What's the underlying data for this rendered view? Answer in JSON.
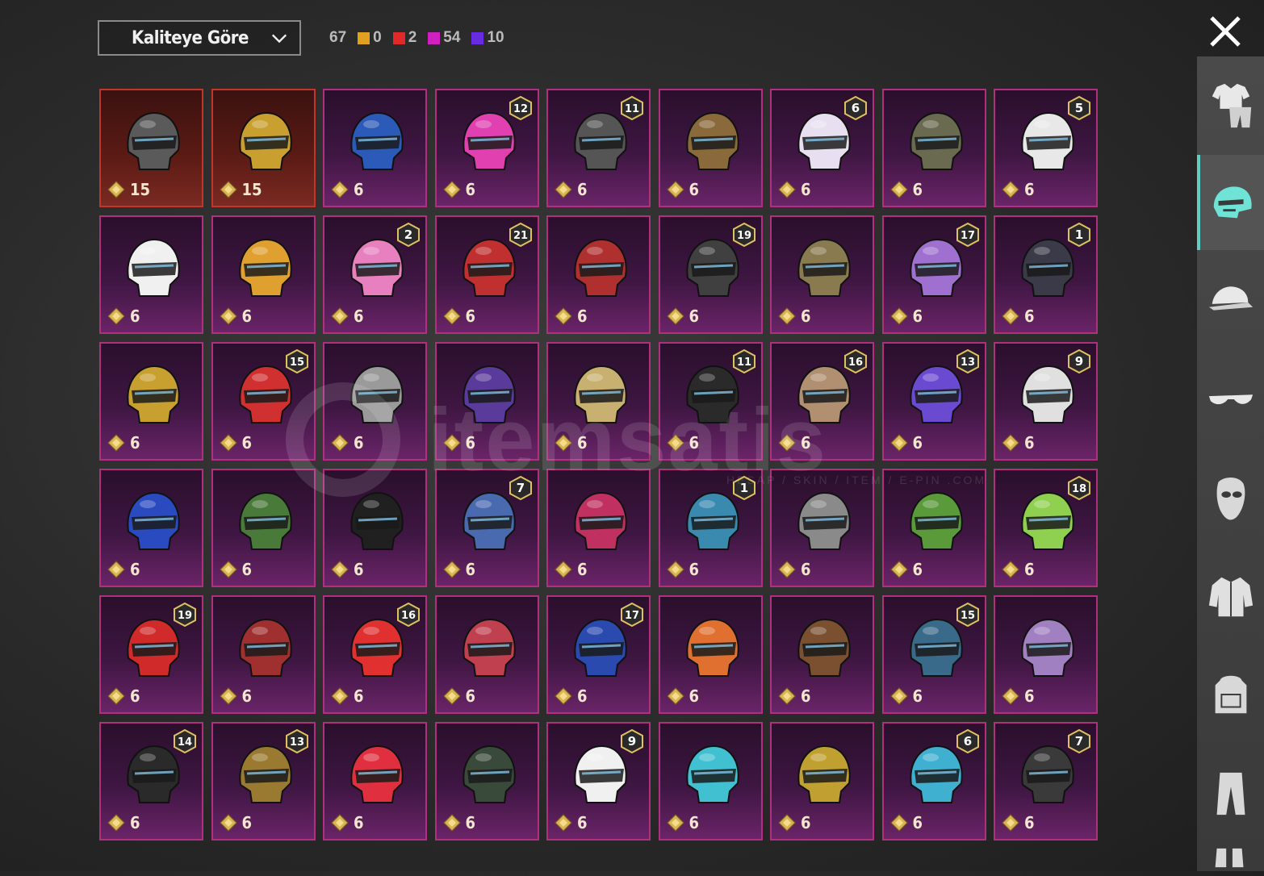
{
  "sort": {
    "label": "Kaliteye Göre"
  },
  "counts": {
    "total": "67",
    "legendary": {
      "value": "0",
      "color": "#e0a020"
    },
    "epic_red": {
      "value": "2",
      "color": "#e02a2a"
    },
    "pink": {
      "value": "54",
      "color": "#d020c0"
    },
    "purple": {
      "value": "10",
      "color": "#6a2ae0"
    }
  },
  "watermark": {
    "text": "itemsatis",
    "sub": "HESAP / SKIN / ITEM / E-PIN .COM"
  },
  "items": [
    {
      "cost": "15",
      "level": "",
      "tier": "legend",
      "color": "#5a5a5a"
    },
    {
      "cost": "15",
      "level": "",
      "tier": "legend",
      "color": "#c9a030"
    },
    {
      "cost": "6",
      "level": "",
      "tier": "epic",
      "color": "#2c5ab8"
    },
    {
      "cost": "6",
      "level": "12",
      "tier": "epic",
      "color": "#e040b0"
    },
    {
      "cost": "6",
      "level": "11",
      "tier": "epic",
      "color": "#555555"
    },
    {
      "cost": "6",
      "level": "",
      "tier": "epic",
      "color": "#8a6a3a"
    },
    {
      "cost": "6",
      "level": "6",
      "tier": "epic",
      "color": "#e8e0f0"
    },
    {
      "cost": "6",
      "level": "",
      "tier": "epic",
      "color": "#6a6a50"
    },
    {
      "cost": "6",
      "level": "5",
      "tier": "epic",
      "color": "#e8e8e8"
    },
    {
      "cost": "6",
      "level": "",
      "tier": "epic",
      "color": "#f0f0f0"
    },
    {
      "cost": "6",
      "level": "",
      "tier": "epic",
      "color": "#e0a030"
    },
    {
      "cost": "6",
      "level": "2",
      "tier": "epic",
      "color": "#e880c0"
    },
    {
      "cost": "6",
      "level": "21",
      "tier": "epic",
      "color": "#c03030"
    },
    {
      "cost": "6",
      "level": "",
      "tier": "epic",
      "color": "#b03030"
    },
    {
      "cost": "6",
      "level": "19",
      "tier": "epic",
      "color": "#404040"
    },
    {
      "cost": "6",
      "level": "",
      "tier": "epic",
      "color": "#8a7a50"
    },
    {
      "cost": "6",
      "level": "17",
      "tier": "epic",
      "color": "#a070d0"
    },
    {
      "cost": "6",
      "level": "1",
      "tier": "epic",
      "color": "#3a3a48"
    },
    {
      "cost": "6",
      "level": "",
      "tier": "epic",
      "color": "#c8a030"
    },
    {
      "cost": "6",
      "level": "15",
      "tier": "epic",
      "color": "#d03030"
    },
    {
      "cost": "6",
      "level": "",
      "tier": "epic",
      "color": "#9a9a9a"
    },
    {
      "cost": "6",
      "level": "",
      "tier": "epic",
      "color": "#5a3a9a"
    },
    {
      "cost": "6",
      "level": "",
      "tier": "epic",
      "color": "#c8b070"
    },
    {
      "cost": "6",
      "level": "11",
      "tier": "epic",
      "color": "#2a2a2a"
    },
    {
      "cost": "6",
      "level": "16",
      "tier": "epic",
      "color": "#b09070"
    },
    {
      "cost": "6",
      "level": "13",
      "tier": "epic",
      "color": "#6a4ad0"
    },
    {
      "cost": "6",
      "level": "9",
      "tier": "epic",
      "color": "#e0e0e0"
    },
    {
      "cost": "6",
      "level": "",
      "tier": "epic",
      "color": "#2a4ac0"
    },
    {
      "cost": "6",
      "level": "",
      "tier": "epic",
      "color": "#4a7a3a"
    },
    {
      "cost": "6",
      "level": "",
      "tier": "epic",
      "color": "#202020"
    },
    {
      "cost": "6",
      "level": "7",
      "tier": "epic",
      "color": "#4a6ab0"
    },
    {
      "cost": "6",
      "level": "",
      "tier": "epic",
      "color": "#c03060"
    },
    {
      "cost": "6",
      "level": "1",
      "tier": "epic",
      "color": "#3a8ab0"
    },
    {
      "cost": "6",
      "level": "",
      "tier": "epic",
      "color": "#8a8a8a"
    },
    {
      "cost": "6",
      "level": "",
      "tier": "epic",
      "color": "#5a9a3a"
    },
    {
      "cost": "6",
      "level": "18",
      "tier": "epic",
      "color": "#90d050"
    },
    {
      "cost": "6",
      "level": "19",
      "tier": "epic",
      "color": "#d02a2a"
    },
    {
      "cost": "6",
      "level": "",
      "tier": "epic",
      "color": "#a03030"
    },
    {
      "cost": "6",
      "level": "16",
      "tier": "epic",
      "color": "#e03030"
    },
    {
      "cost": "6",
      "level": "",
      "tier": "epic",
      "color": "#c04050"
    },
    {
      "cost": "6",
      "level": "17",
      "tier": "epic",
      "color": "#2a4ab0"
    },
    {
      "cost": "6",
      "level": "",
      "tier": "epic",
      "color": "#e07030"
    },
    {
      "cost": "6",
      "level": "",
      "tier": "epic",
      "color": "#7a5030"
    },
    {
      "cost": "6",
      "level": "15",
      "tier": "epic",
      "color": "#3a6a8a"
    },
    {
      "cost": "6",
      "level": "",
      "tier": "epic",
      "color": "#a080c0"
    },
    {
      "cost": "6",
      "level": "14",
      "tier": "epic",
      "color": "#2a2a2a"
    },
    {
      "cost": "6",
      "level": "13",
      "tier": "epic",
      "color": "#9a7a30"
    },
    {
      "cost": "6",
      "level": "",
      "tier": "epic",
      "color": "#e03040"
    },
    {
      "cost": "6",
      "level": "",
      "tier": "epic",
      "color": "#3a4a3a"
    },
    {
      "cost": "6",
      "level": "9",
      "tier": "epic",
      "color": "#f0f0f0"
    },
    {
      "cost": "6",
      "level": "",
      "tier": "epic",
      "color": "#40c0d0"
    },
    {
      "cost": "6",
      "level": "",
      "tier": "epic",
      "color": "#c0a030"
    },
    {
      "cost": "6",
      "level": "6",
      "tier": "epic",
      "color": "#40b0d0"
    },
    {
      "cost": "6",
      "level": "7",
      "tier": "epic",
      "color": "#3a3a3a"
    }
  ],
  "sidebar": [
    {
      "icon": "outfit-icon"
    },
    {
      "icon": "helmet-icon"
    },
    {
      "icon": "cap-icon"
    },
    {
      "icon": "glasses-icon"
    },
    {
      "icon": "mask-icon"
    },
    {
      "icon": "jacket-icon"
    },
    {
      "icon": "backpack-icon"
    },
    {
      "icon": "pants-icon"
    },
    {
      "icon": "shoes-icon"
    }
  ]
}
